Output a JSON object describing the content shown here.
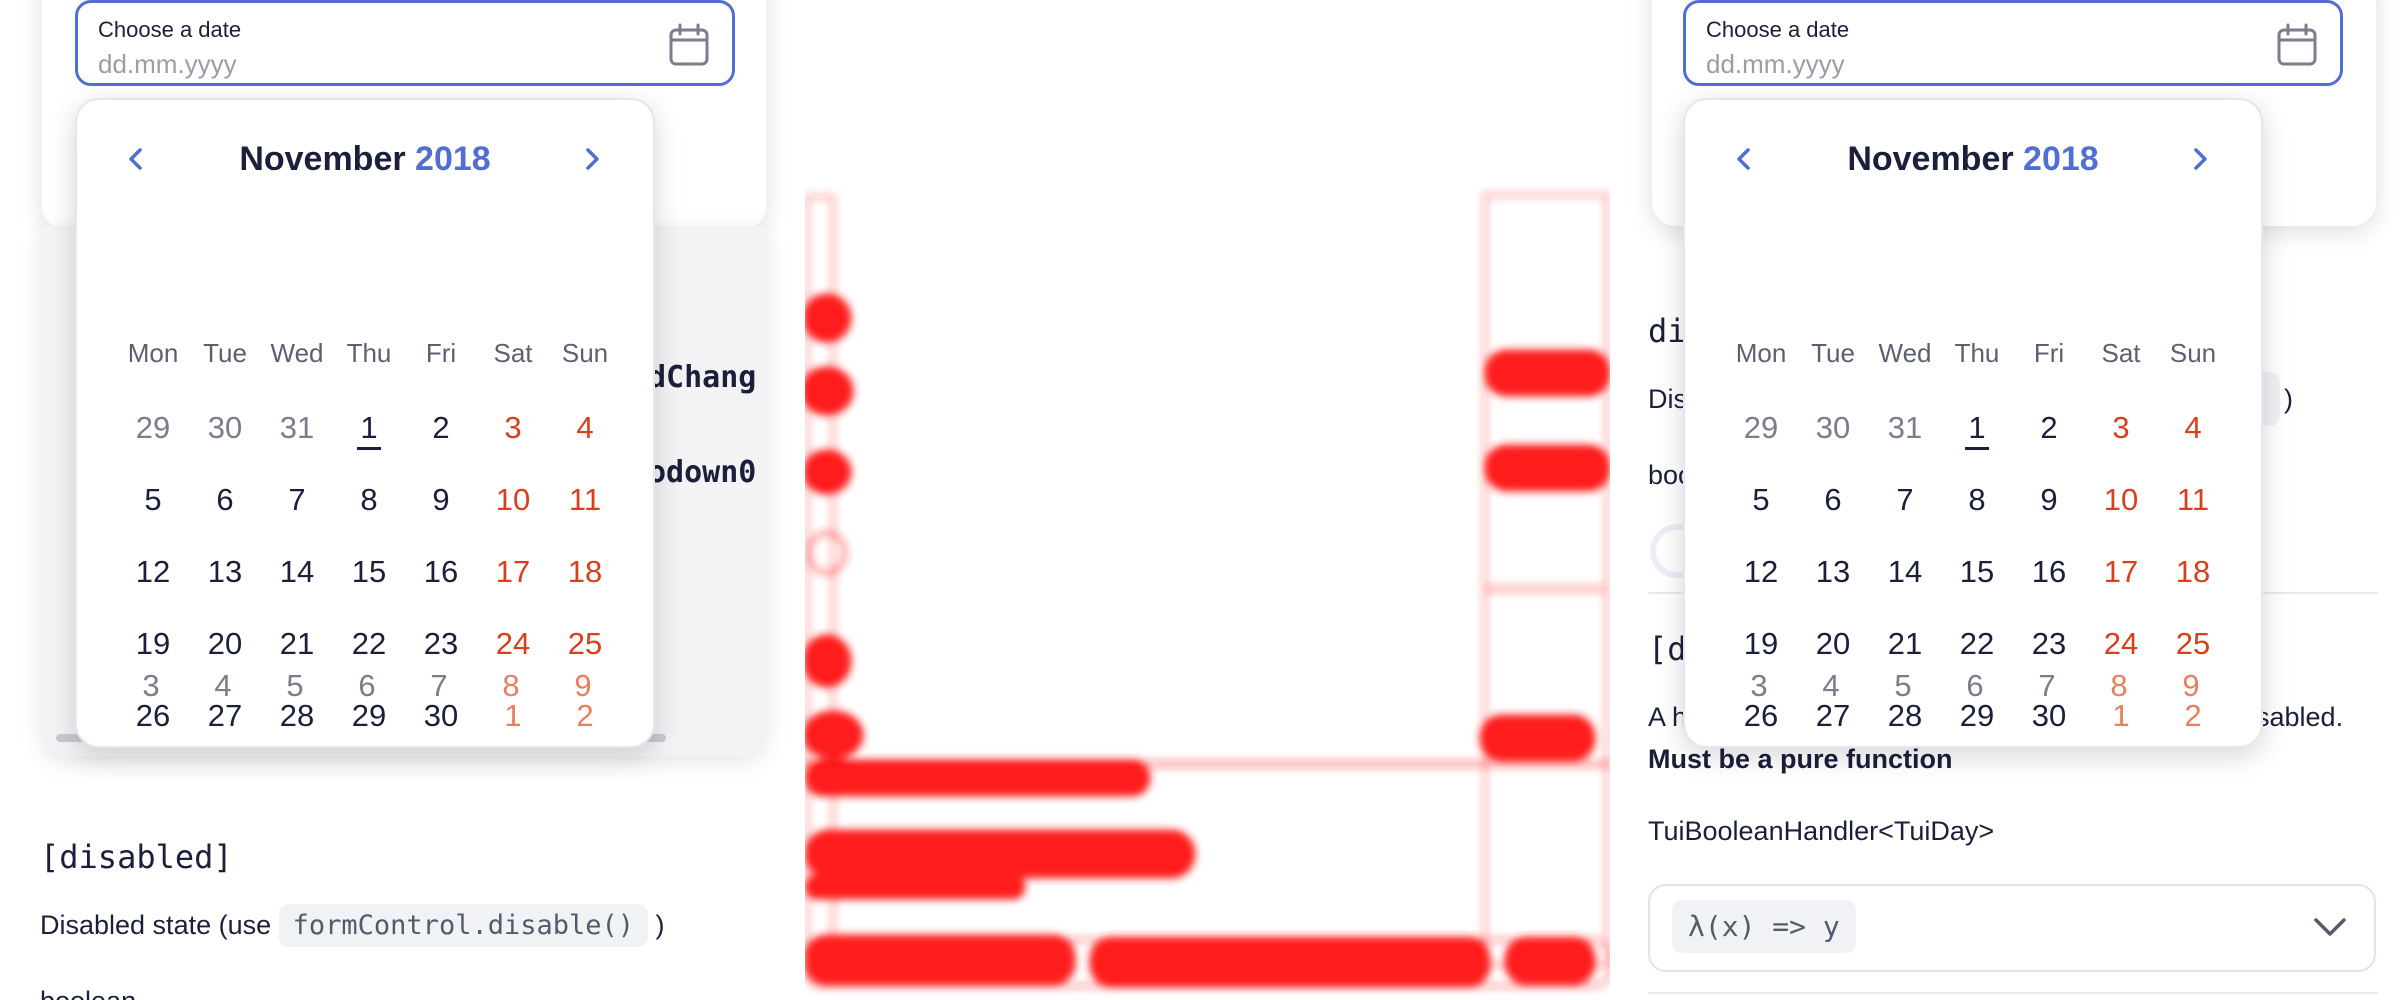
{
  "date_field": {
    "label": "Choose a date",
    "placeholder": "dd.mm.yyyy"
  },
  "calendar": {
    "month": "November",
    "year": "2018",
    "weekdays": [
      "Mon",
      "Tue",
      "Wed",
      "Thu",
      "Fri",
      "Sat",
      "Sun"
    ],
    "weeks": [
      [
        "29",
        "30",
        "31",
        "1",
        "2",
        "3",
        "4"
      ],
      [
        "5",
        "6",
        "7",
        "8",
        "9",
        "10",
        "11"
      ],
      [
        "12",
        "13",
        "14",
        "15",
        "16",
        "17",
        "18"
      ],
      [
        "19",
        "20",
        "21",
        "22",
        "23",
        "24",
        "25"
      ],
      [
        "26",
        "27",
        "28",
        "29",
        "30",
        "1",
        "2"
      ],
      [
        "3",
        "4",
        "5",
        "6",
        "7",
        "8",
        "9"
      ]
    ]
  },
  "left": {
    "snippet_1": "dChang",
    "snippet_2": "odown0",
    "disabled_title": "[disabled]",
    "disabled_desc_prefix": "Disabled state (use",
    "disabled_code": "formControl.disable()",
    "disabled_desc_suffix": ")",
    "disabled_type": "boolean"
  },
  "right": {
    "disabled_title_partial": "di",
    "disabled_desc_partial": "Dis",
    "disabled_desc_suffix": ")",
    "type_partial": "boo",
    "handler_title_partial": "[d",
    "handler_desc_partial_start": "A h",
    "handler_desc_partial_end": "sabled.",
    "handler_note": "Must be a pure function",
    "handler_type": "TuiBooleanHandler<TuiDay>",
    "handler_value": "λ(x) => y"
  },
  "colors": {
    "accent": "#526ed3",
    "weekend": "#d8401c",
    "code_purple": "#8a6cd0",
    "code_green": "#2aa17a",
    "image_red": "#ff0000"
  }
}
